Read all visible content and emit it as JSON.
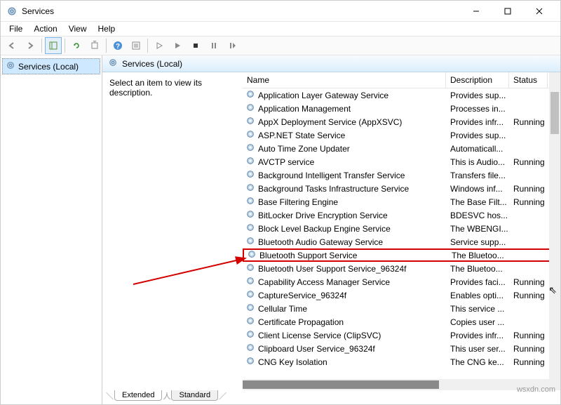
{
  "title": "Services",
  "menus": {
    "file": "File",
    "action": "Action",
    "view": "View",
    "help": "Help"
  },
  "tree": {
    "root": "Services (Local)"
  },
  "header": "Services (Local)",
  "desc_prompt": "Select an item to view its description.",
  "columns": {
    "name": "Name",
    "description": "Description",
    "status": "Status"
  },
  "tabs": {
    "extended": "Extended",
    "standard": "Standard"
  },
  "watermark": "wsxdn.com",
  "services": [
    {
      "name": "Application Layer Gateway Service",
      "desc": "Provides sup...",
      "status": ""
    },
    {
      "name": "Application Management",
      "desc": "Processes in...",
      "status": ""
    },
    {
      "name": "AppX Deployment Service (AppXSVC)",
      "desc": "Provides infr...",
      "status": "Running"
    },
    {
      "name": "ASP.NET State Service",
      "desc": "Provides sup...",
      "status": ""
    },
    {
      "name": "Auto Time Zone Updater",
      "desc": "Automaticall...",
      "status": ""
    },
    {
      "name": "AVCTP service",
      "desc": "This is Audio...",
      "status": "Running"
    },
    {
      "name": "Background Intelligent Transfer Service",
      "desc": "Transfers file...",
      "status": ""
    },
    {
      "name": "Background Tasks Infrastructure Service",
      "desc": "Windows inf...",
      "status": "Running"
    },
    {
      "name": "Base Filtering Engine",
      "desc": "The Base Filt...",
      "status": "Running"
    },
    {
      "name": "BitLocker Drive Encryption Service",
      "desc": "BDESVC hos...",
      "status": ""
    },
    {
      "name": "Block Level Backup Engine Service",
      "desc": "The WBENGI...",
      "status": ""
    },
    {
      "name": "Bluetooth Audio Gateway Service",
      "desc": "Service supp...",
      "status": ""
    },
    {
      "name": "Bluetooth Support Service",
      "desc": "The Bluetoo...",
      "status": "",
      "hl": true
    },
    {
      "name": "Bluetooth User Support Service_96324f",
      "desc": "The Bluetoo...",
      "status": ""
    },
    {
      "name": "Capability Access Manager Service",
      "desc": "Provides faci...",
      "status": "Running"
    },
    {
      "name": "CaptureService_96324f",
      "desc": "Enables opti...",
      "status": "Running"
    },
    {
      "name": "Cellular Time",
      "desc": "This service ...",
      "status": ""
    },
    {
      "name": "Certificate Propagation",
      "desc": "Copies user ...",
      "status": ""
    },
    {
      "name": "Client License Service (ClipSVC)",
      "desc": "Provides infr...",
      "status": "Running"
    },
    {
      "name": "Clipboard User Service_96324f",
      "desc": "This user ser...",
      "status": "Running"
    },
    {
      "name": "CNG Key Isolation",
      "desc": "The CNG ke...",
      "status": "Running"
    }
  ]
}
